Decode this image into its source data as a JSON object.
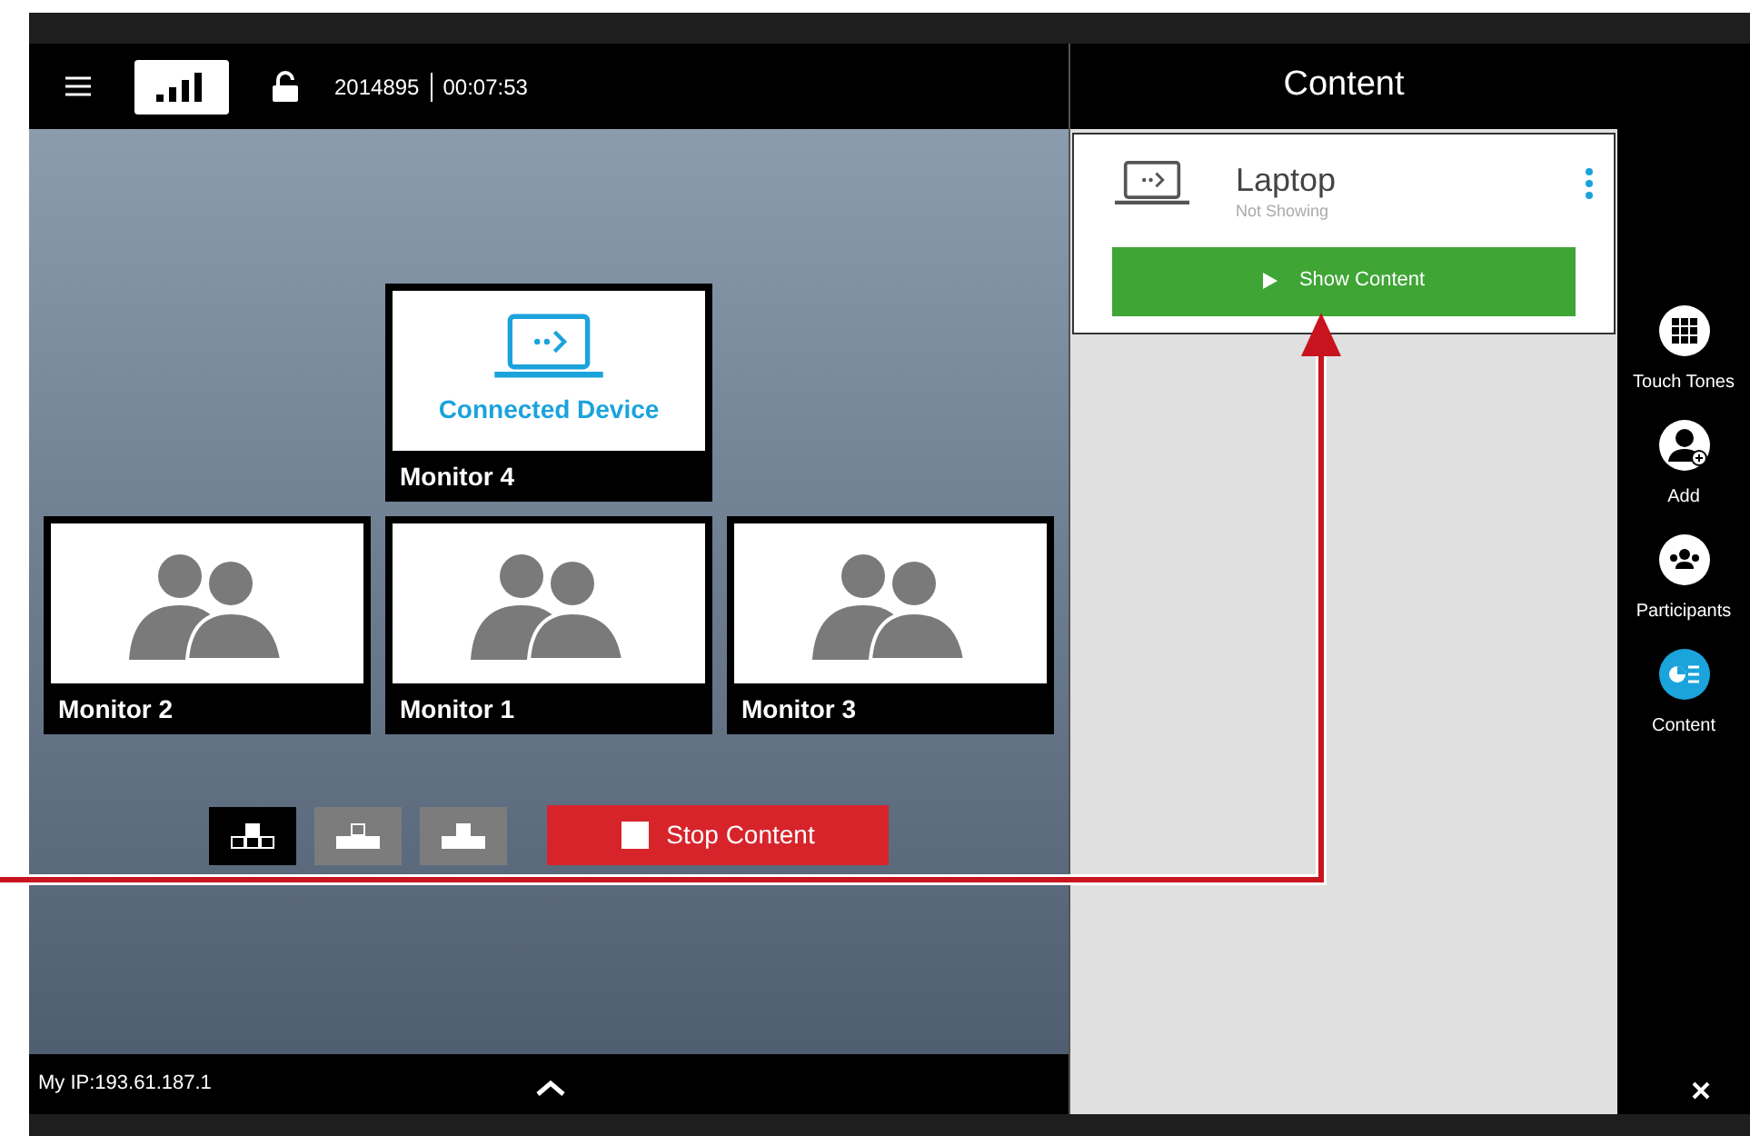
{
  "top_bar": {
    "meeting_id": "2014895",
    "duration": "00:07:53"
  },
  "monitors": [
    {
      "label": "Monitor 4",
      "kind": "device",
      "caption": "Connected Device"
    },
    {
      "label": "Monitor 2",
      "kind": "people"
    },
    {
      "label": "Monitor 1",
      "kind": "people"
    },
    {
      "label": "Monitor 3",
      "kind": "people"
    }
  ],
  "layouts": [
    {
      "kind": "outline-bottom",
      "selected": true
    },
    {
      "kind": "outline-top",
      "selected": false
    },
    {
      "kind": "filled",
      "selected": false
    }
  ],
  "stop_button": "Stop Content",
  "status_bar": {
    "ip": "My IP:193.61.187.1"
  },
  "content_panel": {
    "title": "Content",
    "items": [
      {
        "name": "Laptop",
        "status": "Not Showing",
        "action": "Show Content"
      }
    ]
  },
  "rail": [
    {
      "kind": "keypad",
      "label": "Touch Tones",
      "selected": false
    },
    {
      "kind": "add-person",
      "label": "Add",
      "selected": false
    },
    {
      "kind": "group",
      "label": "Participants",
      "selected": false
    },
    {
      "kind": "content",
      "label": "Content",
      "selected": true
    }
  ]
}
